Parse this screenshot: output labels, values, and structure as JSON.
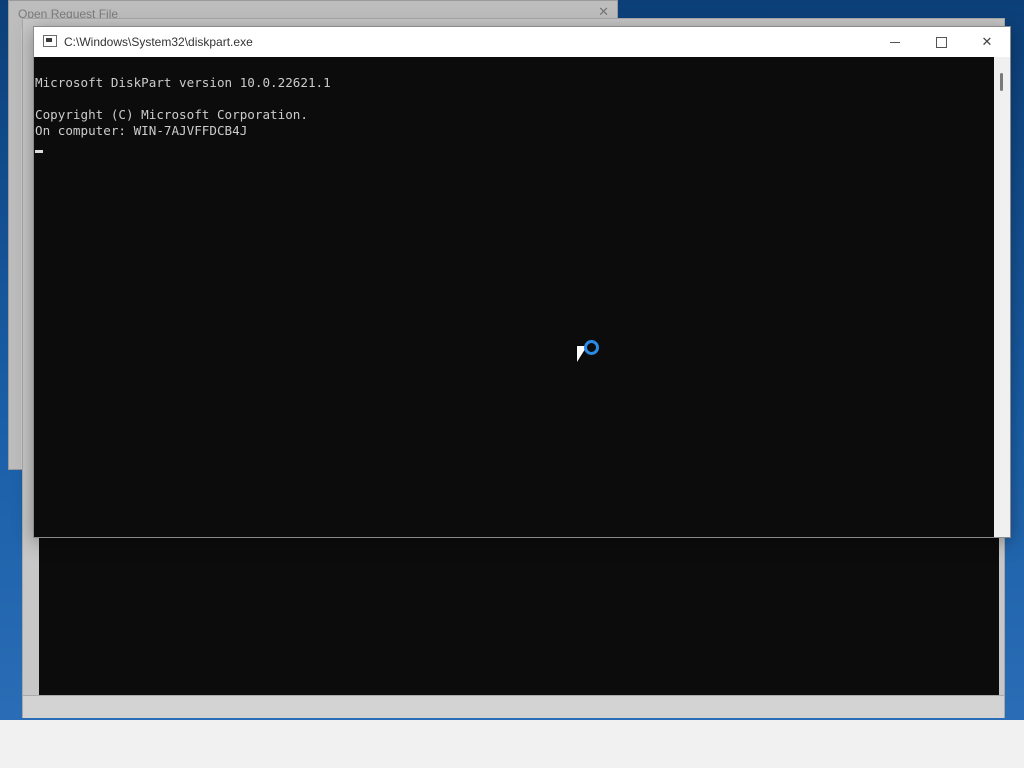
{
  "background_dialog": {
    "title": "Open Request File",
    "close_symbol": "✕"
  },
  "window": {
    "title": "C:\\Windows\\System32\\diskpart.exe",
    "icon": "console-icon",
    "controls": {
      "minimize": "minimize",
      "maximize": "maximize",
      "close": "✕"
    }
  },
  "console": {
    "lines": [
      "Microsoft DiskPart version 10.0.22621.1",
      "",
      "Copyright (C) Microsoft Corporation.",
      "On computer: WIN-7AJVFFDCB4J"
    ]
  },
  "colors": {
    "console_bg": "#0c0c0c",
    "console_text": "#cccccc",
    "busy_ring": "#2b8ae6"
  }
}
